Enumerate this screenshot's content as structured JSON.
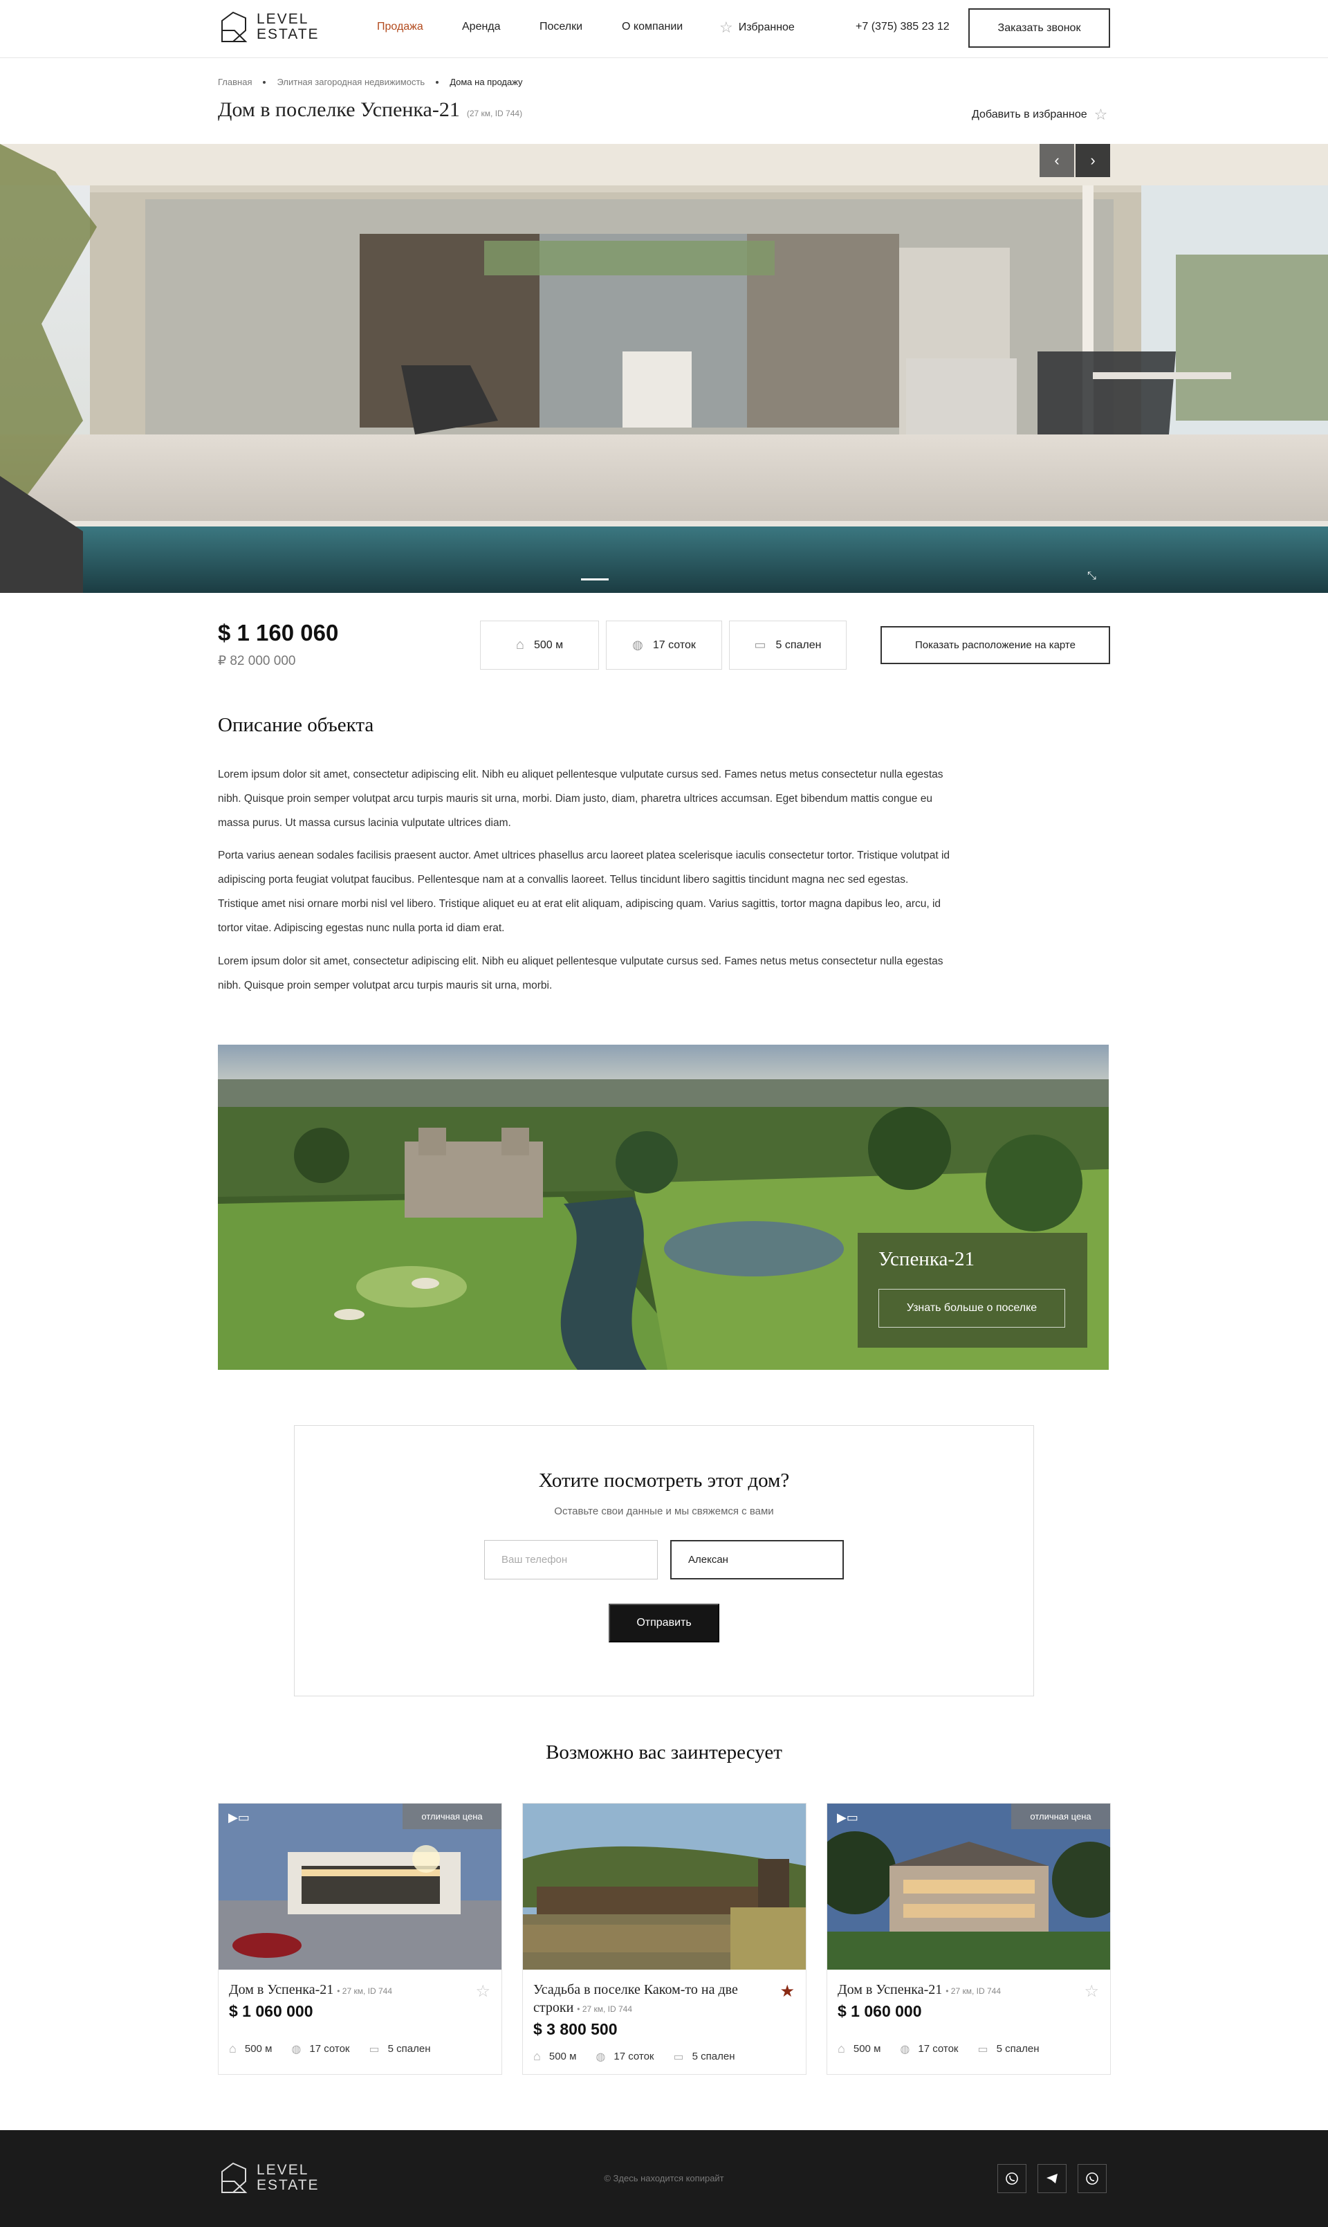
{
  "header": {
    "logo": {
      "line1": "LEVEL",
      "line2": "ESTATE"
    },
    "nav": [
      "Продажа",
      "Аренда",
      "Поселки",
      "О компании",
      "Избранное"
    ],
    "phone": "+7 (375) 385 23 12",
    "callback_button": "Заказать звонок"
  },
  "breadcrumbs": [
    "Главная",
    "Элитная загородная недвижимость",
    "Дома на продажу"
  ],
  "property": {
    "title": "Дом в послелке Успенка-21",
    "meta": "(27 км, ID 744)",
    "add_favorite": "Добавить в избранное",
    "price_usd": "$ 1 160 060",
    "price_rub": "₽ 82 000 000",
    "features": [
      "500 м",
      "17 соток",
      "5 спален"
    ],
    "map_button": "Показать расположение на карте"
  },
  "description": {
    "heading": "Описание объекта",
    "paragraphs": [
      "Lorem ipsum dolor sit amet, consectetur adipiscing elit. Nibh eu aliquet pellentesque vulputate cursus sed. Fames netus metus consectetur nulla egestas nibh. Quisque proin semper volutpat arcu turpis mauris sit urna, morbi. Diam justo, diam, pharetra ultrices accumsan. Eget bibendum mattis congue eu massa purus. Ut massa cursus lacinia vulputate ultrices diam.",
      "Porta varius aenean sodales facilisis praesent auctor. Amet ultrices phasellus arcu laoreet platea scelerisque iaculis consectetur tortor. Tristique volutpat id adipiscing porta feugiat volutpat faucibus. Pellentesque nam at a convallis laoreet. Tellus tincidunt libero sagittis tincidunt magna nec sed egestas. Tristique amet nisi ornare morbi nisl vel libero. Tristique aliquet eu at erat elit aliquam, adipiscing quam. Varius sagittis, tortor magna dapibus leo, arcu, id tortor vitae. Adipiscing egestas nunc nulla porta id diam erat.",
      "Lorem ipsum dolor sit amet, consectetur adipiscing elit. Nibh eu aliquet pellentesque vulputate cursus sed. Fames netus metus consectetur nulla egestas nibh. Quisque proin semper volutpat arcu turpis mauris sit urna, morbi."
    ]
  },
  "village": {
    "name": "Успенка-21",
    "button": "Узнать больше о поселке"
  },
  "form": {
    "heading": "Хотите посмотреть этот дом?",
    "subheading": "Оставьте свои данные и мы свяжемся с вами",
    "phone_placeholder": "Ваш телефон",
    "name_value": "Алексан",
    "submit": "Отправить"
  },
  "related": {
    "heading": "Возможно вас заинтересует",
    "cards": [
      {
        "badge": "отличная цена",
        "title": "Дом в Успенка-21",
        "meta": "27 км, ID 744",
        "price": "$ 1 060 000",
        "features": [
          "500 м",
          "17 соток",
          "5 спален"
        ],
        "favorite": false
      },
      {
        "badge": "",
        "title": "Усадьба в поселке Каком-то на две строки",
        "meta": "27 км, ID 744",
        "price": "$ 3 800 500",
        "features": [
          "500 м",
          "17 соток",
          "5 спален"
        ],
        "favorite": true
      },
      {
        "badge": "отличная цена",
        "title": "Дом в Успенка-21",
        "meta": "27 км, ID 744",
        "price": "$ 1 060 000",
        "features": [
          "500 м",
          "17 соток",
          "5 спален"
        ],
        "favorite": false
      }
    ]
  },
  "footer": {
    "copyright": "© Здесь находится копирайт",
    "socials": [
      "viber-icon",
      "telegram-icon",
      "whatsapp-icon"
    ]
  },
  "colors": {
    "accent": "#b24a1d",
    "dark": "#1b1b1b",
    "favorite": "#8a2a14"
  }
}
